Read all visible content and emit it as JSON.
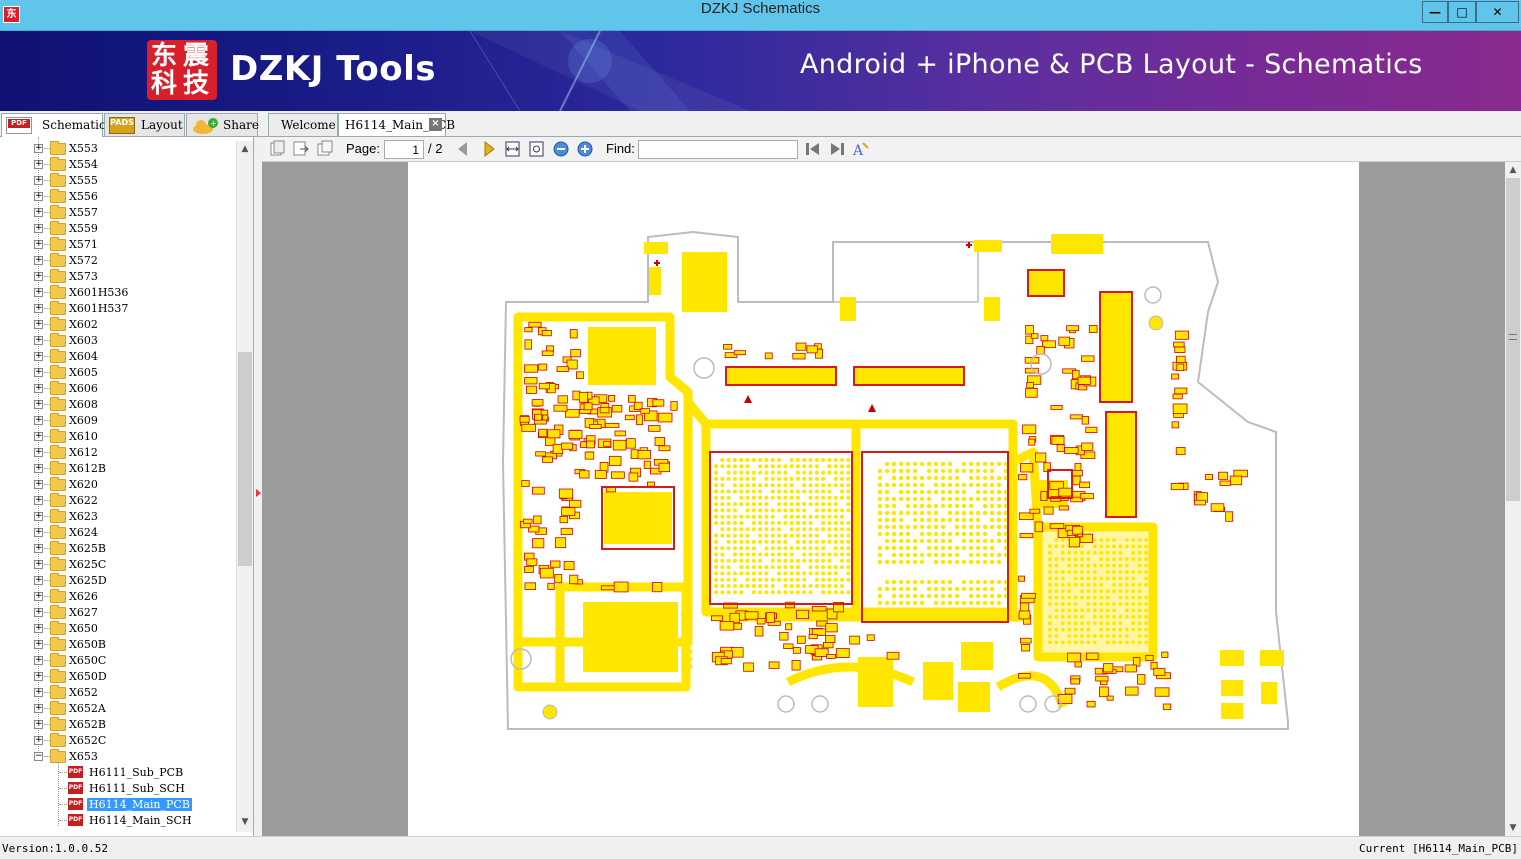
{
  "window": {
    "title": "DZKJ Schematics",
    "icon_letter": "东",
    "minimize": "—",
    "maximize": "□",
    "close": "✕"
  },
  "banner": {
    "logo_chars": [
      "东",
      "震",
      "科",
      "技"
    ],
    "brand": "DZKJ Tools",
    "tagline": "Android + iPhone & PCB Layout - Schematics"
  },
  "left_tabs": [
    {
      "label": "Schematic",
      "icon": "pdf-icon",
      "active": true
    },
    {
      "label": "Layout",
      "icon": "pads-icon",
      "active": false
    },
    {
      "label": "Share",
      "icon": "cloud-share-icon",
      "active": false
    }
  ],
  "icon_texts": {
    "pdf": "PDF",
    "pads": "PADS"
  },
  "doc_tabs": [
    {
      "label": "Welcome",
      "active": false
    },
    {
      "label": "H6114_Main_PCB",
      "active": true
    }
  ],
  "tree": {
    "folders": [
      "X553",
      "X554",
      "X555",
      "X556",
      "X557",
      "X559",
      "X571",
      "X572",
      "X573",
      "X601H536",
      "X601H537",
      "X602",
      "X603",
      "X604",
      "X605",
      "X606",
      "X608",
      "X609",
      "X610",
      "X612",
      "X612B",
      "X620",
      "X622",
      "X623",
      "X624",
      "X625B",
      "X625C",
      "X625D",
      "X626",
      "X627",
      "X650",
      "X650B",
      "X650C",
      "X650D",
      "X652",
      "X652A",
      "X652B",
      "X652C",
      "X653"
    ],
    "expanded_folder": "X653",
    "files": [
      {
        "label": "H6111_Sub_PCB",
        "selected": false
      },
      {
        "label": "H6111_Sub_SCH",
        "selected": false
      },
      {
        "label": "H6114_Main_PCB",
        "selected": true
      },
      {
        "label": "H6114_Main_SCH",
        "selected": false
      }
    ]
  },
  "toolbar": {
    "page_label": "Page:",
    "page_current": "1",
    "page_total": "/ 2",
    "find_label": "Find:",
    "find_value": ""
  },
  "status": {
    "version": "Version:1.0.0.52",
    "current": "Current [H6114_Main_PCB]"
  }
}
